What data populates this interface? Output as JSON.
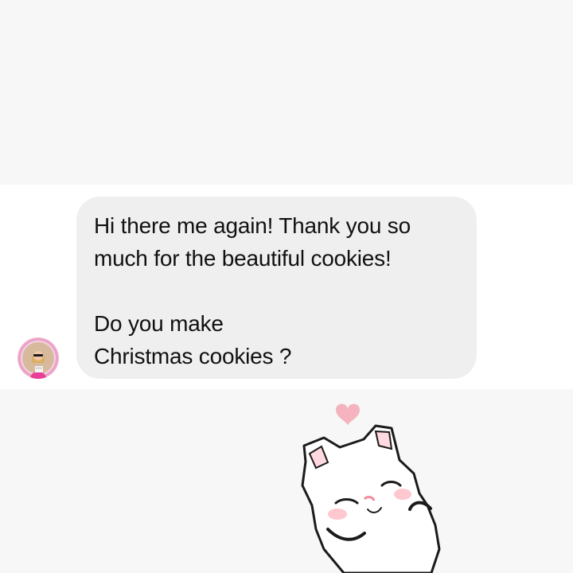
{
  "conversation": {
    "incoming_message": {
      "paragraph_1": "Hi there me again! Thank you so\nmuch for the beautiful cookies!",
      "paragraph_2": "Do you make\nChristmas cookies ?"
    },
    "sender_avatar": {
      "icon": "profile-photo"
    },
    "sticker": {
      "icon": "white-cat-with-heart-sticker"
    }
  },
  "colors": {
    "page_background": "#f7f7f7",
    "message_strip": "#ffffff",
    "bubble_background": "#efefef",
    "text": "#111111",
    "heart": "#f4b3be",
    "avatar_ring": "#e87fb8"
  }
}
